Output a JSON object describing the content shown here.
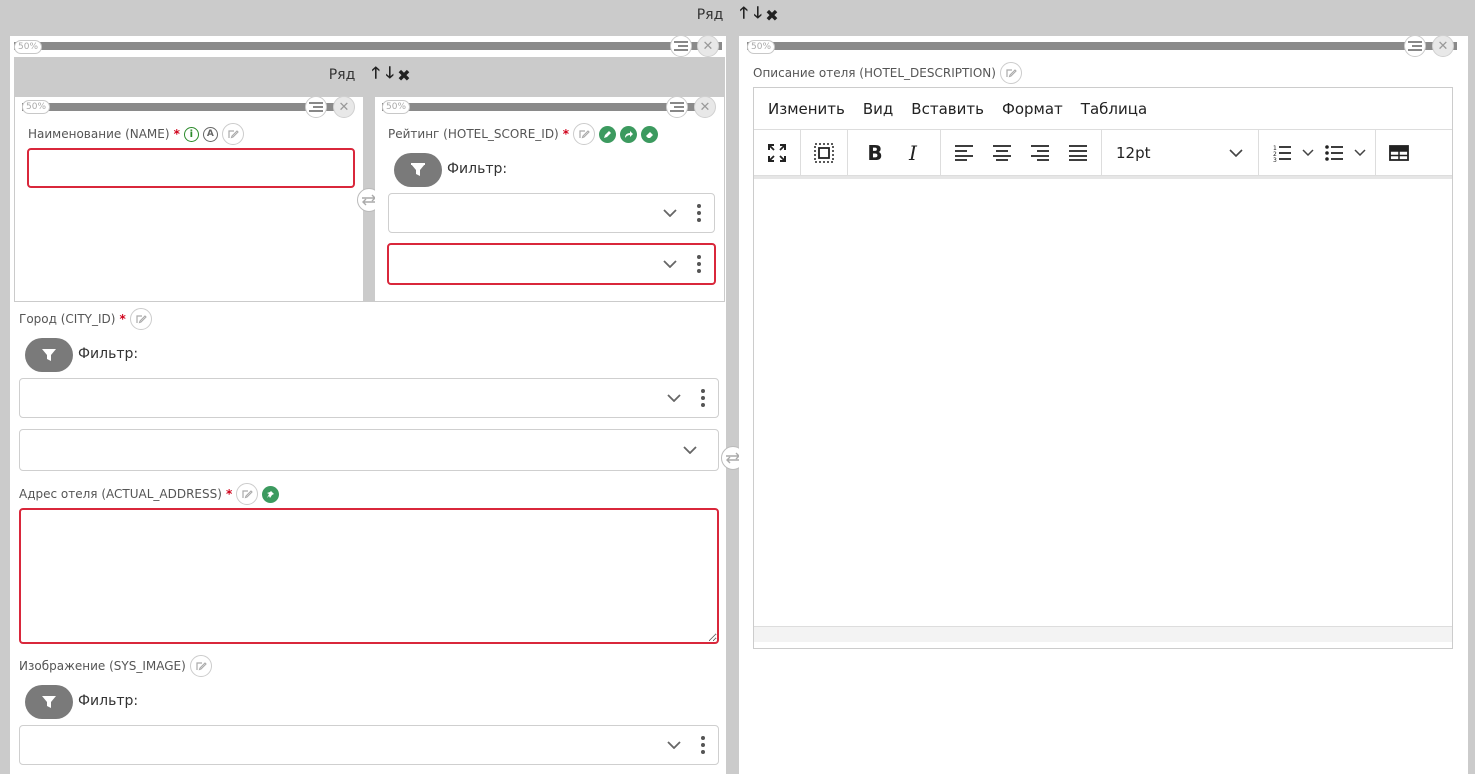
{
  "top_row": {
    "label": "Ряд",
    "up": "🡑",
    "down": "🡓",
    "close": "✖"
  },
  "left_column": {
    "width_badge": "50%"
  },
  "right_column": {
    "width_badge": "50%"
  },
  "inner_row": {
    "label": "Ряд",
    "up": "🡑",
    "down": "🡓",
    "close": "✖",
    "left_col_badge": "50%",
    "right_col_badge": "50%"
  },
  "fields": {
    "name": {
      "label": "Наименование (NAME)",
      "required": "*",
      "value": ""
    },
    "hotel_score": {
      "label": "Рейтинг (HOTEL_SCORE_ID)",
      "required": "*",
      "filter_label": "Фильтр:"
    },
    "city": {
      "label": "Город (CITY_ID)",
      "required": "*",
      "filter_label": "Фильтр:"
    },
    "address": {
      "label": "Адрес отеля (ACTUAL_ADDRESS)",
      "required": "*",
      "value": ""
    },
    "image": {
      "label": "Изображение (SYS_IMAGE)",
      "filter_label": "Фильтр:"
    },
    "description": {
      "label": "Описание отеля (HOTEL_DESCRIPTION)"
    }
  },
  "editor": {
    "menu": [
      "Изменить",
      "Вид",
      "Вставить",
      "Формат",
      "Таблица"
    ],
    "font_size": "12pt",
    "bold": "B",
    "italic": "I"
  },
  "colors": {
    "error_border": "#d9273b",
    "green_action": "#3c9a5f",
    "frame_gray": "#cbcbcb"
  }
}
